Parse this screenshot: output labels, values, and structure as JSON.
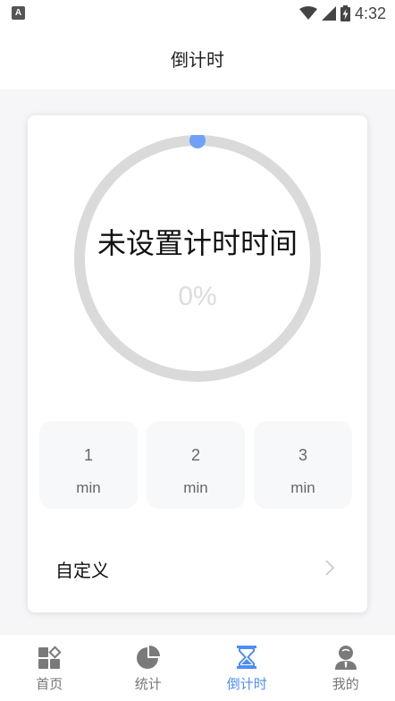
{
  "status_bar": {
    "notification_icon": "A",
    "time": "4:32",
    "icons": [
      "wifi-icon",
      "cell-signal-icon",
      "battery-charging-icon"
    ]
  },
  "header": {
    "title": "倒计时"
  },
  "timer": {
    "label": "未设置计时时间",
    "percent_text": "0%",
    "progress": 0
  },
  "presets": [
    {
      "value": "1",
      "unit": "min"
    },
    {
      "value": "2",
      "unit": "min"
    },
    {
      "value": "3",
      "unit": "min"
    }
  ],
  "custom": {
    "label": "自定义"
  },
  "tabs": [
    {
      "label": "首页",
      "icon": "home-grid-icon",
      "active": false
    },
    {
      "label": "统计",
      "icon": "pie-chart-icon",
      "active": false
    },
    {
      "label": "倒计时",
      "icon": "hourglass-icon",
      "active": true
    },
    {
      "label": "我的",
      "icon": "user-profile-icon",
      "active": false
    }
  ],
  "colors": {
    "accent": "#4e8df5",
    "ring_track": "#dadada",
    "ring_knob": "#6ea1f7",
    "icon_inactive": "#7a7a7a"
  }
}
